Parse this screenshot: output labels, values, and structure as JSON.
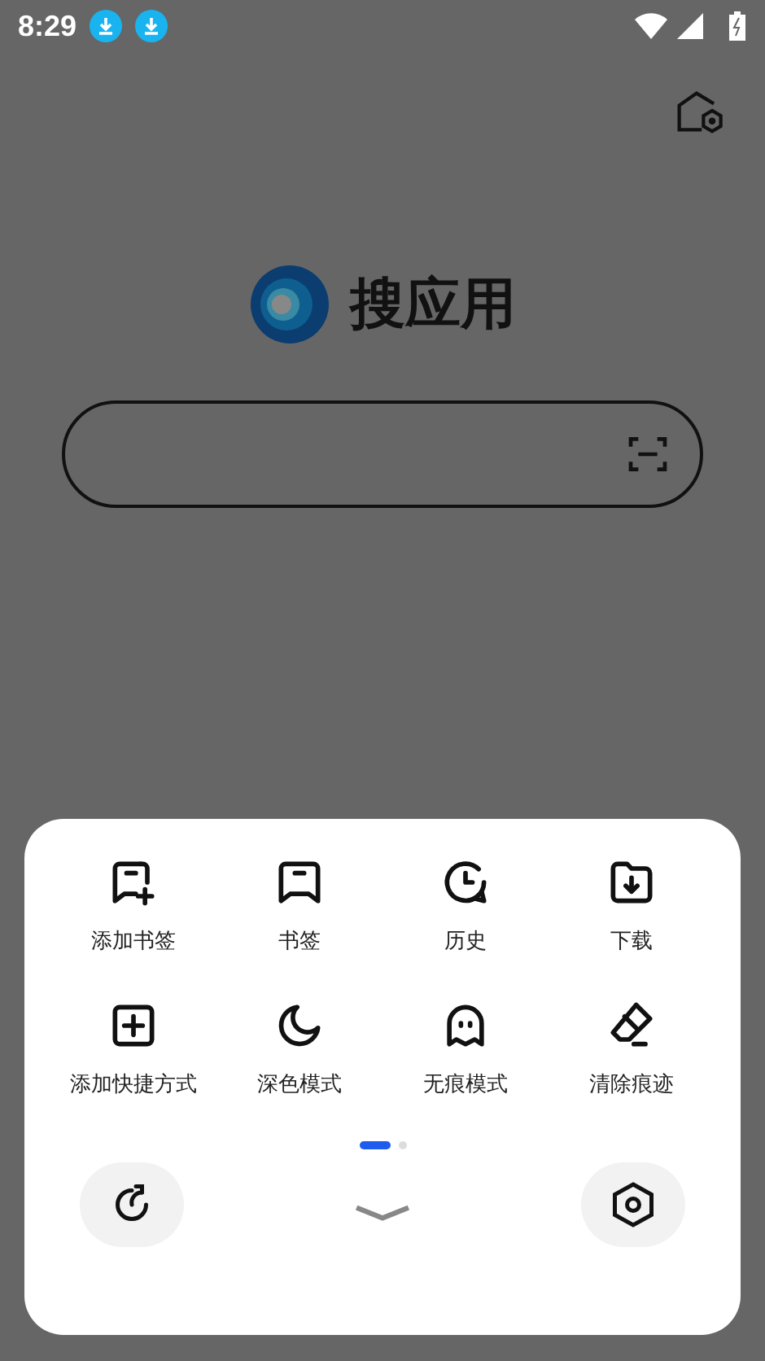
{
  "status_bar": {
    "time": "8:29",
    "notifications": [
      {
        "kind": "download"
      },
      {
        "kind": "download"
      }
    ]
  },
  "logo": {
    "text": "搜应用"
  },
  "menu": {
    "items": [
      {
        "kind": "add-bookmark",
        "label": "添加书签"
      },
      {
        "kind": "bookmark",
        "label": "书签"
      },
      {
        "kind": "history",
        "label": "历史"
      },
      {
        "kind": "download",
        "label": "下载"
      },
      {
        "kind": "add-shortcut",
        "label": "添加快捷方式"
      },
      {
        "kind": "dark-mode",
        "label": "深色模式"
      },
      {
        "kind": "incognito",
        "label": "无痕模式"
      },
      {
        "kind": "clear",
        "label": "清除痕迹"
      }
    ],
    "pages": [
      {
        "selected": true
      },
      {
        "selected": false
      }
    ]
  }
}
